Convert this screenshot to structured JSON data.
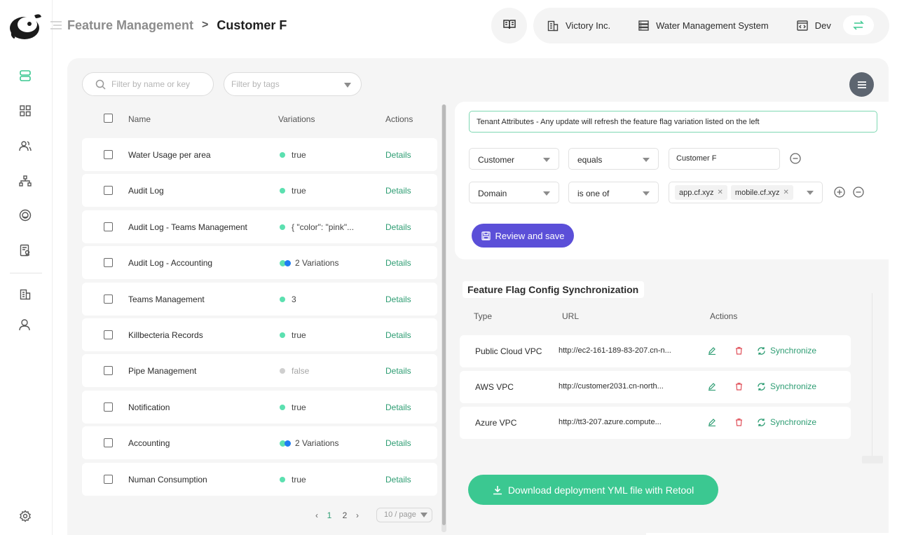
{
  "breadcrumb": {
    "parent": "Feature Management",
    "separator": ">",
    "current": "Customer F"
  },
  "context": {
    "company": "Victory Inc.",
    "system": "Water Management System",
    "environment": "Dev"
  },
  "filters": {
    "name_placeholder": "Filter by name or key",
    "tags_placeholder": "Filter by tags"
  },
  "table": {
    "headers": {
      "name": "Name",
      "variations": "Variations",
      "actions": "Actions"
    },
    "rows": [
      {
        "name": "Water Usage per area",
        "variation": "true",
        "kind": "single",
        "action": "Details"
      },
      {
        "name": "Audit Log",
        "variation": "true",
        "kind": "single",
        "action": "Details"
      },
      {
        "name": "Audit Log - Teams Management",
        "variation": "{ \"color\": \"pink\"...",
        "kind": "single",
        "action": "Details"
      },
      {
        "name": "Audit Log - Accounting",
        "variation": "2 Variations",
        "kind": "multi",
        "action": "Details"
      },
      {
        "name": "Teams Management",
        "variation": "3",
        "kind": "single",
        "action": "Details"
      },
      {
        "name": "Killbecteria Records",
        "variation": "true",
        "kind": "single",
        "action": "Details"
      },
      {
        "name": "Pipe Management",
        "variation": "false",
        "kind": "off",
        "action": "Details"
      },
      {
        "name": "Notification",
        "variation": "true",
        "kind": "single",
        "action": "Details"
      },
      {
        "name": "Accounting",
        "variation": "2 Variations",
        "kind": "multi",
        "action": "Details"
      },
      {
        "name": "Numan Consumption",
        "variation": "true",
        "kind": "single",
        "action": "Details"
      }
    ]
  },
  "pagination": {
    "pages": [
      "1",
      "2"
    ],
    "current": "1",
    "page_size": "10 / page"
  },
  "tenant": {
    "note": "Tenant Attributes - Any update will refresh the feature flag variation listed on the left",
    "rule1": {
      "attribute": "Customer",
      "operator": "equals",
      "value": "Customer F"
    },
    "rule2": {
      "attribute": "Domain",
      "operator": "is one of",
      "values": [
        "app.cf.xyz",
        "mobile.cf.xyz"
      ]
    },
    "save_label": "Review and save"
  },
  "sync": {
    "title": "Feature Flag Config Synchronization",
    "headers": {
      "type": "Type",
      "url": "URL",
      "actions": "Actions"
    },
    "rows": [
      {
        "type": "Public Cloud VPC",
        "url": "http://ec2-161-189-83-207.cn-n...",
        "action": "Synchronize"
      },
      {
        "type": "AWS VPC",
        "url": "http://customer2031.cn-north...",
        "action": "Synchronize"
      },
      {
        "type": "Azure VPC",
        "url": "http://tt3-207.azure.compute...",
        "action": "Synchronize"
      }
    ]
  },
  "download_label": "Download deployment YML file with Retool",
  "colors": {
    "accent_green": "#2e9d73",
    "primary_purple": "#5b4fd8",
    "download_green": "#3bc891"
  }
}
